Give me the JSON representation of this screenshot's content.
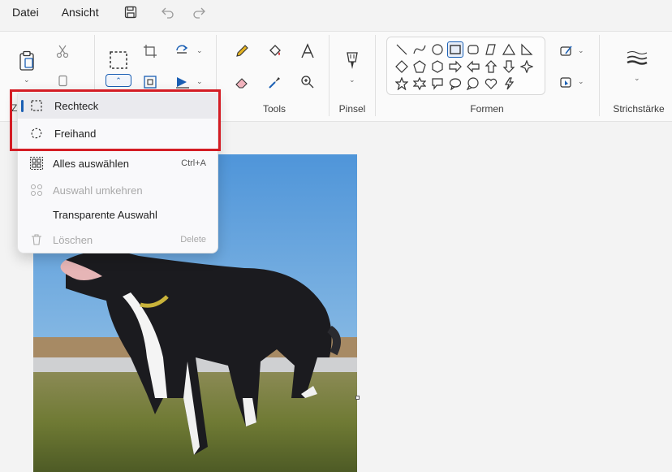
{
  "menubar": {
    "file": "Datei",
    "view": "Ansicht"
  },
  "ribbon": {
    "groups": {
      "tools": "Tools",
      "brushes": "Pinsel",
      "shapes": "Formen",
      "stroke": "Strichstärke"
    },
    "clipboard_letter": "Z"
  },
  "selection_menu": {
    "items": [
      {
        "label": "Rechteck",
        "shortcut": "",
        "icon": "rect-select-icon",
        "selected": true,
        "enabled": true
      },
      {
        "label": "Freihand",
        "shortcut": "",
        "icon": "freeform-select-icon",
        "selected": false,
        "enabled": true
      },
      {
        "label": "Alles auswählen",
        "shortcut": "Ctrl+A",
        "icon": "select-all-icon",
        "selected": false,
        "enabled": true
      },
      {
        "label": "Auswahl umkehren",
        "shortcut": "",
        "icon": "invert-selection-icon",
        "selected": false,
        "enabled": false
      },
      {
        "label": "Transparente Auswahl",
        "shortcut": "",
        "icon": "",
        "selected": false,
        "enabled": true
      },
      {
        "label": "Löschen",
        "shortcut": "Delete",
        "icon": "trash-icon",
        "selected": false,
        "enabled": false
      }
    ]
  },
  "colors": {
    "accent": "#1a5fb4",
    "highlight_box": "#d41c24"
  }
}
